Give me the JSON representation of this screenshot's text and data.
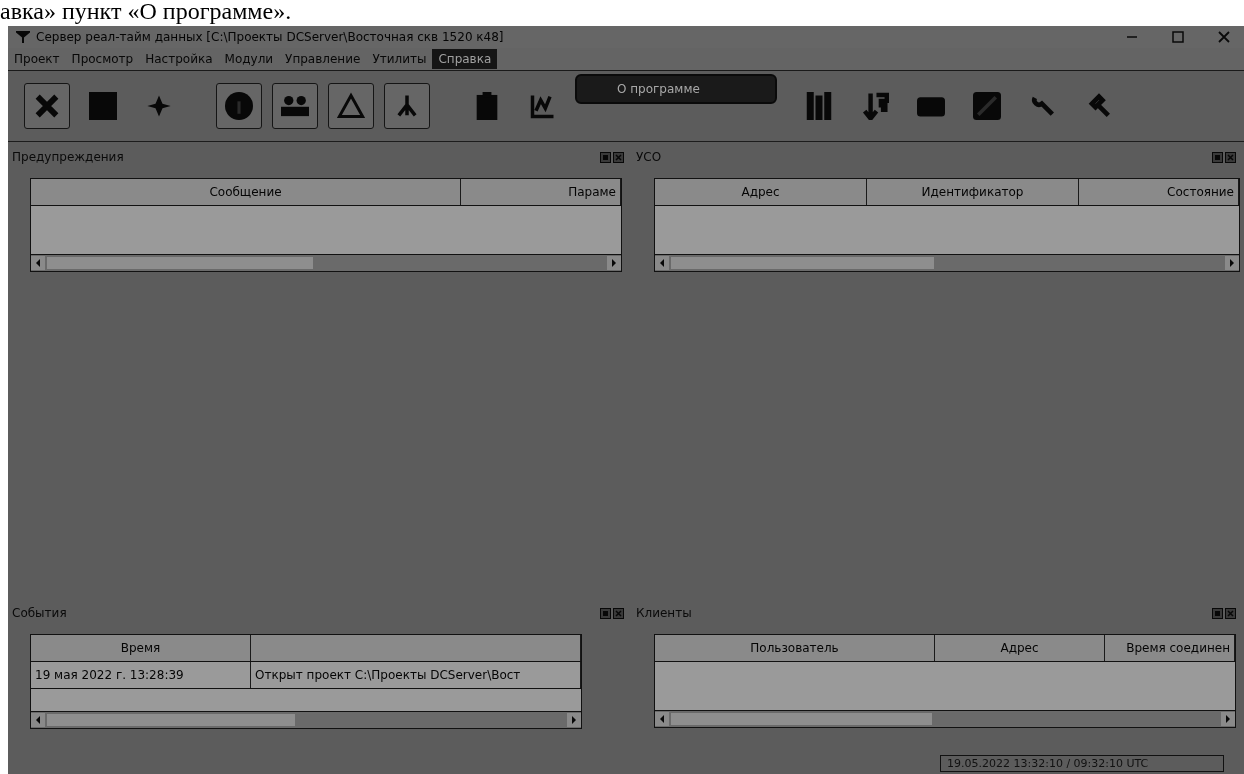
{
  "caption": "авка» пункт «О программе».",
  "window": {
    "title": "Сервер реал-тайм данных [C:\\Проекты DCServer\\Восточная скв 1520 к48]"
  },
  "menu": [
    {
      "label": "Проект",
      "selected": false
    },
    {
      "label": "Просмотр",
      "selected": false
    },
    {
      "label": "Настройка",
      "selected": false
    },
    {
      "label": "Модули",
      "selected": false
    },
    {
      "label": "Управление",
      "selected": false
    },
    {
      "label": "Утилиты",
      "selected": false
    },
    {
      "label": "Справка",
      "selected": true
    }
  ],
  "dropdown": [
    {
      "label": "О программе"
    }
  ],
  "toolbar": [
    {
      "kind": "tools",
      "pressed": true
    },
    {
      "kind": "square",
      "pressed": false
    },
    {
      "kind": "plane",
      "pressed": false
    },
    {
      "kind": "info",
      "pressed": true
    },
    {
      "kind": "people",
      "pressed": true
    },
    {
      "kind": "warning",
      "pressed": true
    },
    {
      "kind": "tree",
      "pressed": true
    },
    {
      "kind": "clipboard",
      "pressed": false
    },
    {
      "kind": "chart",
      "pressed": false
    },
    {
      "kind": "bars",
      "pressed": false
    },
    {
      "kind": "download",
      "pressed": false
    },
    {
      "kind": "block",
      "pressed": false
    },
    {
      "kind": "disk",
      "pressed": false
    },
    {
      "kind": "wrench",
      "pressed": false
    },
    {
      "kind": "hammer",
      "pressed": false
    }
  ],
  "panels": [
    {
      "title": "Предупреждения",
      "columns": [
        "Сообщение",
        "Параме"
      ]
    },
    {
      "title": "УСО",
      "columns": [
        "Адрес",
        "Идентификатор",
        "Состояние"
      ]
    },
    {
      "title": "События",
      "columns": [
        "Время"
      ],
      "rows": [
        [
          "19 мая 2022 г. 13:28:39",
          "Открыт проект C:\\Проекты DCServer\\Вост"
        ]
      ]
    },
    {
      "title": "Клиенты",
      "columns": [
        "Пользователь",
        "Адрес",
        "Время соединен"
      ]
    }
  ],
  "status_bar": {
    "clock": "19.05.2022 13:32:10 / 09:32:10 UTC"
  }
}
